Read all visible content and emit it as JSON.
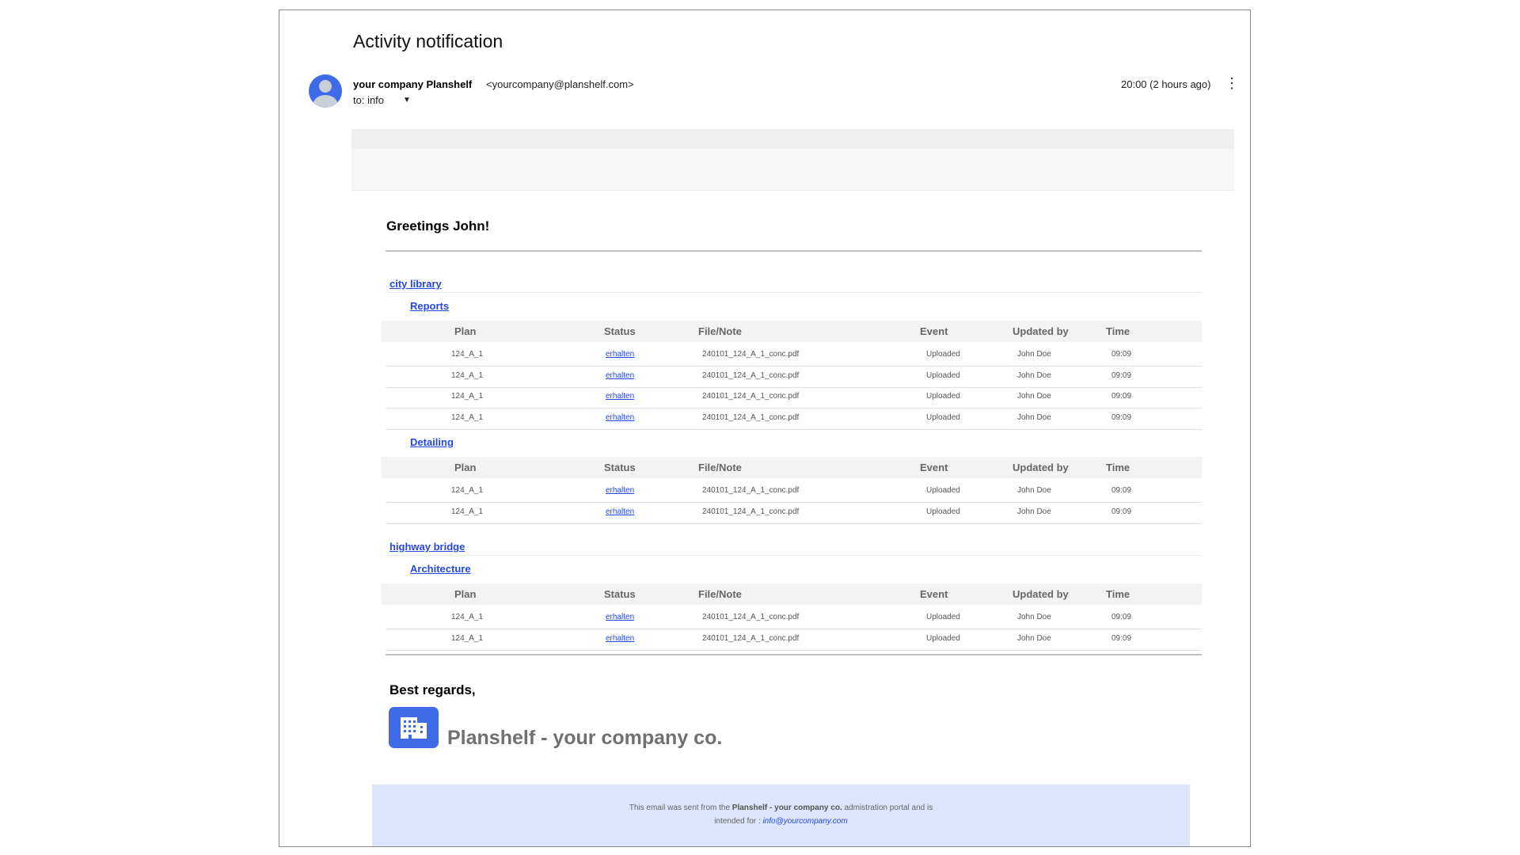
{
  "email": {
    "subject": "Activity notification",
    "sender_name": "your company Planshelf",
    "sender_email": "<yourcompany@planshelf.com>",
    "to": "to: info",
    "time": "20:00 (2 hours ago)"
  },
  "body": {
    "greeting": "Greetings John!",
    "columns": {
      "plan": "Plan",
      "status": "Status",
      "file": "File/Note",
      "event": "Event",
      "updated_by": "Updated by",
      "time": "Time"
    },
    "projects": [
      {
        "name": "city library",
        "categories": [
          {
            "name": "Reports",
            "rows": [
              {
                "plan": "124_A_1",
                "status": "erhalten",
                "file": "240101_124_A_1_conc.pdf",
                "event": "Uploaded",
                "updated_by": "John Doe",
                "time": "09:09"
              },
              {
                "plan": "124_A_1",
                "status": "erhalten",
                "file": "240101_124_A_1_conc.pdf",
                "event": "Uploaded",
                "updated_by": "John Doe",
                "time": "09:09"
              },
              {
                "plan": "124_A_1",
                "status": "erhalten",
                "file": "240101_124_A_1_conc.pdf",
                "event": "Uploaded",
                "updated_by": "John Doe",
                "time": "09:09"
              },
              {
                "plan": "124_A_1",
                "status": "erhalten",
                "file": "240101_124_A_1_conc.pdf",
                "event": "Uploaded",
                "updated_by": "John Doe",
                "time": "09:09"
              }
            ]
          },
          {
            "name": "Detailing",
            "rows": [
              {
                "plan": "124_A_1",
                "status": "erhalten",
                "file": "240101_124_A_1_conc.pdf",
                "event": "Uploaded",
                "updated_by": "John Doe",
                "time": "09:09"
              },
              {
                "plan": "124_A_1",
                "status": "erhalten",
                "file": "240101_124_A_1_conc.pdf",
                "event": "Uploaded",
                "updated_by": "John Doe",
                "time": "09:09"
              }
            ]
          }
        ]
      },
      {
        "name": "highway bridge",
        "categories": [
          {
            "name": "Architecture",
            "rows": [
              {
                "plan": "124_A_1",
                "status": "erhalten",
                "file": "240101_124_A_1_conc.pdf",
                "event": "Uploaded",
                "updated_by": "John Doe",
                "time": "09:09"
              },
              {
                "plan": "124_A_1",
                "status": "erhalten",
                "file": "240101_124_A_1_conc.pdf",
                "event": "Uploaded",
                "updated_by": "John Doe",
                "time": "09:09"
              }
            ]
          }
        ]
      }
    ],
    "regards": "Best regards,",
    "brand": "Planshelf - your company co."
  },
  "footer": {
    "text1": "This email was sent from the",
    "brand": "Planshelf - your company co.",
    "text2": "admistration portal and is",
    "text3": "intended for :",
    "email": "info@yourcompany.com"
  },
  "icons": {
    "avatar": "user-avatar-icon",
    "more": "more-vertical-icon",
    "caret": "caret-down-icon",
    "logo": "building-icon"
  },
  "colors": {
    "accent": "#3f6be8",
    "link": "#2647e8",
    "footer_bg": "#dde5fc"
  }
}
